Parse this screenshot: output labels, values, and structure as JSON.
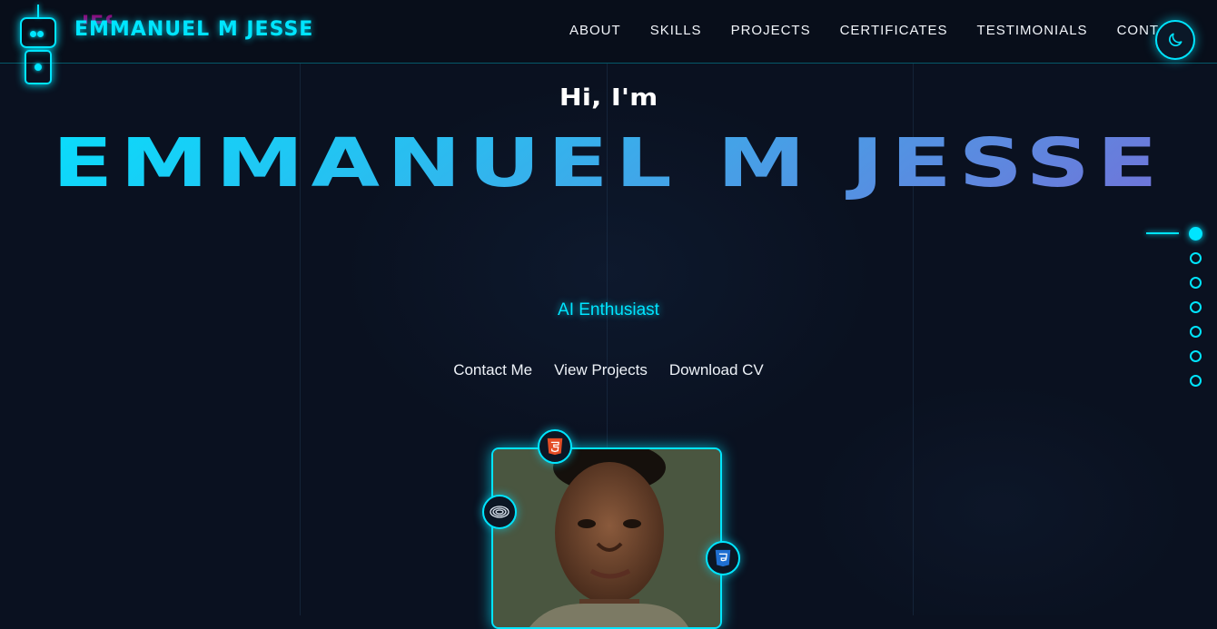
{
  "header": {
    "logo_text": "EMMANUEL M JESSE",
    "logo_glitch_text": "JESSE",
    "nav": [
      "ABOUT",
      "SKILLS",
      "PROJECTS",
      "CERTIFICATES",
      "TESTIMONIALS",
      "CONTACT"
    ],
    "theme_toggle_icon": "moon-icon"
  },
  "hero": {
    "greeting": "Hi, I'm",
    "name": "EMMANUEL M JESSE",
    "role": "AI Enthusiast",
    "actions": [
      "Contact Me",
      "View Projects",
      "Download CV"
    ]
  },
  "section_dots": {
    "count": 7,
    "active_index": 0
  },
  "photo": {
    "badges": [
      "html5-icon",
      "swift-icon",
      "css3-icon"
    ]
  },
  "colors": {
    "background": "#0a1120",
    "accent": "#00e5ff",
    "gradient_end": "#7a6ad6",
    "html_orange": "#e44d26",
    "css_blue": "#1f6fd1"
  }
}
